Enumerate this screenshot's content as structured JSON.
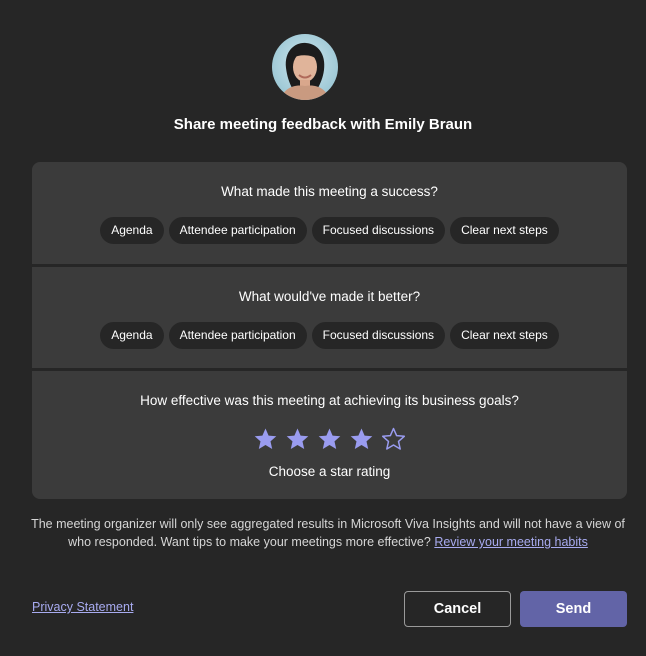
{
  "header": {
    "avatar_icon": "person-avatar",
    "title": "Share meeting feedback with Emily Braun"
  },
  "success_section": {
    "question": "What made this meeting a success?",
    "chips": [
      "Agenda",
      "Attendee participation",
      "Focused discussions",
      "Clear next steps"
    ]
  },
  "better_section": {
    "question": "What would've made it better?",
    "chips": [
      "Agenda",
      "Attendee participation",
      "Focused discussions",
      "Clear next steps"
    ]
  },
  "rating_section": {
    "question": "How effective was this meeting at achieving its business goals?",
    "rating": 4,
    "max_rating": 5,
    "label": "Choose a star rating"
  },
  "footer": {
    "note_text": "The meeting organizer will only see aggregated results in Microsoft Viva Insights and will not have a view of who responded. Want tips to make your meetings more effective?",
    "note_link": "Review your meeting habits",
    "privacy_link": "Privacy Statement",
    "cancel_label": "Cancel",
    "send_label": "Send"
  },
  "colors": {
    "background": "#262626",
    "card": "#3b3b3b",
    "accent": "#6264a7",
    "link": "#a8abf0",
    "star": "#9a9cf0"
  }
}
